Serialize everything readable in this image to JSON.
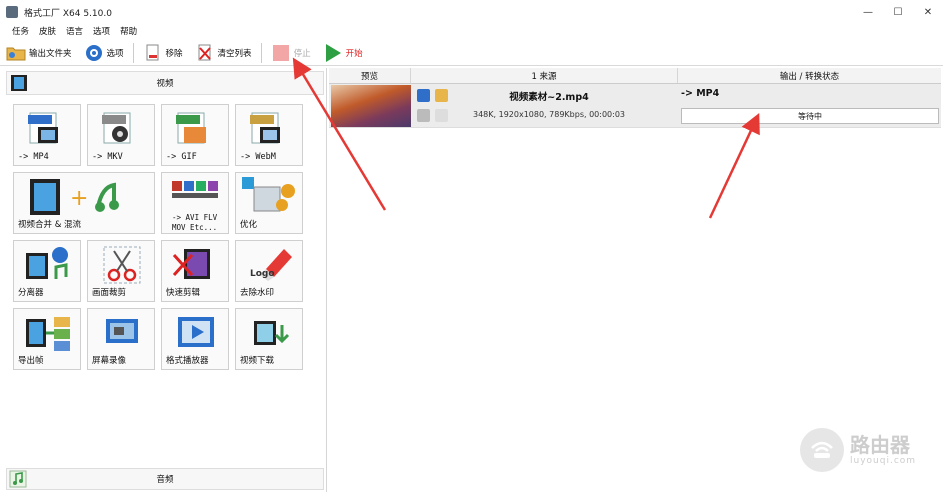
{
  "window": {
    "title": "格式工厂 X64 5.10.0"
  },
  "menu": [
    "任务",
    "皮肤",
    "语言",
    "选项",
    "帮助"
  ],
  "toolbar": {
    "output_folder": "输出文件夹",
    "options": "选项",
    "remove": "移除",
    "clear_list": "清空列表",
    "stop": "停止",
    "start": "开始"
  },
  "sidebar": {
    "video_header": "视频",
    "audio_header": "音频",
    "tiles": [
      {
        "label": "-> MP4",
        "badge": "MP4"
      },
      {
        "label": "-> MKV",
        "badge": "MKV"
      },
      {
        "label": "-> GIF",
        "badge": "GIF"
      },
      {
        "label": "-> WebM",
        "badge": "WebM"
      },
      {
        "label": "视频合并 & 混流"
      },
      {
        "label": "-> AVI FLV\nMOV Etc..."
      },
      {
        "label": "优化"
      },
      {
        "label": "分离器"
      },
      {
        "label": "画面裁剪"
      },
      {
        "label": "快速剪辑"
      },
      {
        "label": "去除水印",
        "logo_text": "Logo"
      },
      {
        "label": "导出帧"
      },
      {
        "label": "屏幕录像"
      },
      {
        "label": "格式播放器"
      },
      {
        "label": "视频下载"
      }
    ]
  },
  "table": {
    "headers": [
      "预览",
      "1 来源",
      "输出 / 转换状态"
    ],
    "rows": [
      {
        "filename": "视频素材~2.mp4",
        "meta": "348K, 1920x1080, 789Kbps, 00:00:03",
        "output": "-> MP4",
        "status": "等待中"
      }
    ]
  },
  "watermark": {
    "name": "路由器",
    "domain": "luyouqi.com"
  },
  "colors": {
    "arrow": "#e53935",
    "start_green": "#2ea043",
    "accent_blue": "#1e6fd9"
  }
}
